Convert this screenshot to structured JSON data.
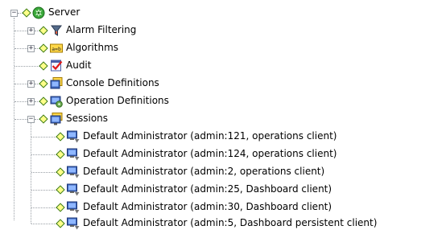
{
  "tree": {
    "root": {
      "label": "Server",
      "icon": "server-gear-icon",
      "expanded": true
    },
    "items": [
      {
        "label": "Alarm Filtering",
        "icon": "filter-icon",
        "expandable": true
      },
      {
        "label": "Algorithms",
        "icon": "algorithm-icon",
        "expandable": true
      },
      {
        "label": "Audit",
        "icon": "audit-checklist-icon",
        "expandable": false
      },
      {
        "label": "Console Definitions",
        "icon": "console-icon",
        "expandable": true
      },
      {
        "label": "Operation Definitions",
        "icon": "operation-icon",
        "expandable": true
      },
      {
        "label": "Sessions",
        "icon": "sessions-icon",
        "expandable": true,
        "expanded": true
      }
    ],
    "sessions": [
      {
        "label": "Default Administrator (admin:121, operations client)",
        "icon": "session-computer-icon"
      },
      {
        "label": "Default Administrator (admin:124, operations client)",
        "icon": "session-computer-icon"
      },
      {
        "label": "Default Administrator (admin:2, operations client)",
        "icon": "session-computer-icon"
      },
      {
        "label": "Default Administrator (admin:25, Dashboard client)",
        "icon": "session-computer-icon"
      },
      {
        "label": "Default Administrator (admin:30, Dashboard client)",
        "icon": "session-computer-icon"
      },
      {
        "label": "Default Administrator (admin:5, Dashboard persistent client)",
        "icon": "session-computer-icon"
      }
    ],
    "colors": {
      "diamond_fill": "#ffff88",
      "diamond_border": "#3a7a1a",
      "connector": "#9aa0a6"
    }
  }
}
